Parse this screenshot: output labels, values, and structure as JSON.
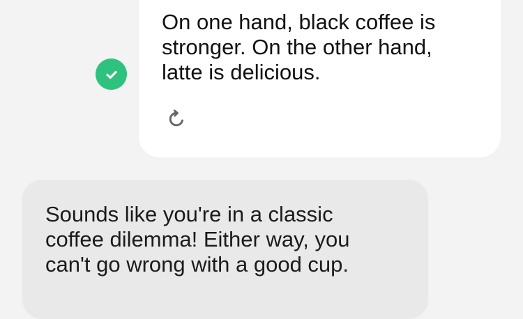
{
  "messages": {
    "user": {
      "text": "On one hand, black coffee is\nstronger. On the other hand,\nlatte is delicious.",
      "status_icon": "check-circle-icon",
      "action_icon": "regenerate-icon"
    },
    "assistant": {
      "text": "Sounds like you're in a classic\ncoffee dilemma! Either way, you\ncan't go wrong with a good cup."
    }
  },
  "colors": {
    "background": "#f3f3f3",
    "user_bubble": "#ffffff",
    "assistant_bubble": "#e9e9e9",
    "check_green": "#2ec27e",
    "icon_gray": "#666666"
  }
}
